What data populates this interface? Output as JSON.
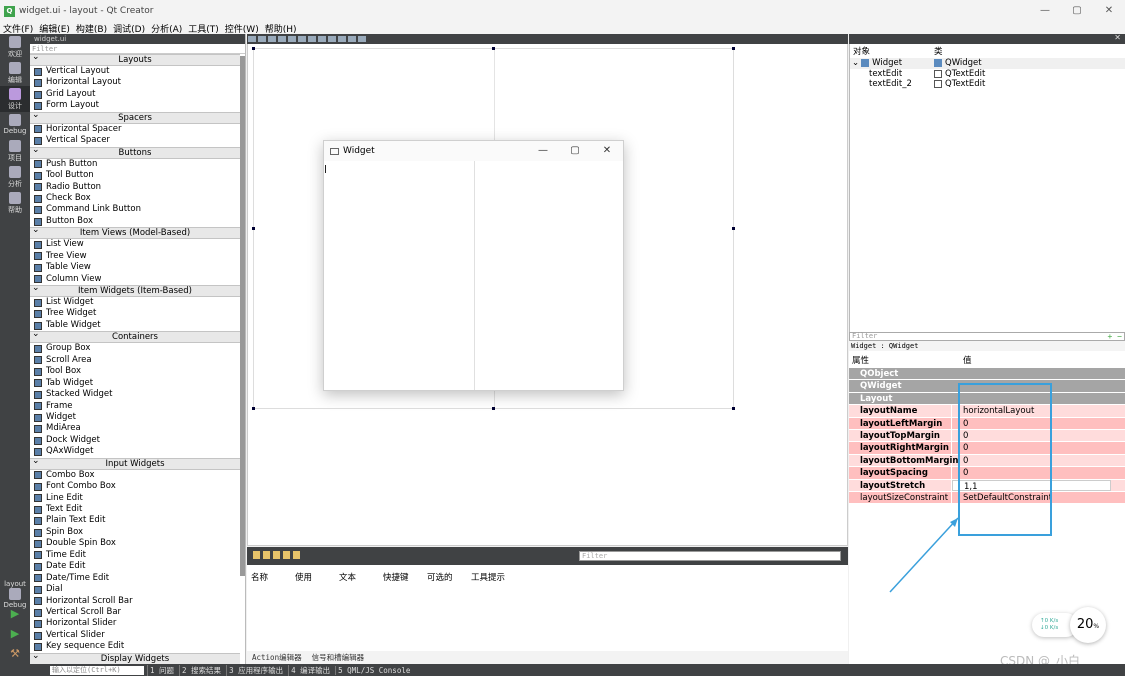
{
  "window": {
    "title": "widget.ui - layout - Qt Creator",
    "minimize": "—",
    "maximize": "▢",
    "close": "✕"
  },
  "menu": [
    "文件(F)",
    "编辑(E)",
    "构建(B)",
    "调试(D)",
    "分析(A)",
    "工具(T)",
    "控件(W)",
    "帮助(H)"
  ],
  "modes": [
    "欢迎",
    "编辑",
    "设计",
    "Debug",
    "项目",
    "分析",
    "帮助"
  ],
  "mode_bottom": {
    "project": "layout",
    "config": "Debug"
  },
  "widgetbox": {
    "file": "widget.ui",
    "filter_placeholder": "Filter",
    "categories": [
      {
        "name": "Layouts",
        "items": [
          "Vertical Layout",
          "Horizontal Layout",
          "Grid Layout",
          "Form Layout"
        ]
      },
      {
        "name": "Spacers",
        "items": [
          "Horizontal Spacer",
          "Vertical Spacer"
        ]
      },
      {
        "name": "Buttons",
        "items": [
          "Push Button",
          "Tool Button",
          "Radio Button",
          "Check Box",
          "Command Link Button",
          "Button Box"
        ]
      },
      {
        "name": "Item Views (Model-Based)",
        "items": [
          "List View",
          "Tree View",
          "Table View",
          "Column View"
        ]
      },
      {
        "name": "Item Widgets (Item-Based)",
        "items": [
          "List Widget",
          "Tree Widget",
          "Table Widget"
        ]
      },
      {
        "name": "Containers",
        "items": [
          "Group Box",
          "Scroll Area",
          "Tool Box",
          "Tab Widget",
          "Stacked Widget",
          "Frame",
          "Widget",
          "MdiArea",
          "Dock Widget",
          "QAxWidget"
        ]
      },
      {
        "name": "Input Widgets",
        "items": [
          "Combo Box",
          "Font Combo Box",
          "Line Edit",
          "Text Edit",
          "Plain Text Edit",
          "Spin Box",
          "Double Spin Box",
          "Time Edit",
          "Date Edit",
          "Date/Time Edit",
          "Dial",
          "Horizontal Scroll Bar",
          "Vertical Scroll Bar",
          "Horizontal Slider",
          "Vertical Slider",
          "Key sequence Edit"
        ]
      },
      {
        "name": "Display Widgets",
        "items": []
      }
    ]
  },
  "preview": {
    "title": "Widget",
    "minimize": "—",
    "maximize": "▢",
    "close": "✕"
  },
  "actions": {
    "filter_placeholder": "Filter",
    "columns": [
      "名称",
      "使用",
      "文本",
      "快捷键",
      "可选的",
      "工具提示"
    ],
    "tabs": [
      "Action编辑器",
      "信号和槽编辑器"
    ]
  },
  "objects": {
    "header": [
      "对象",
      "类"
    ],
    "rows": [
      {
        "name": "Widget",
        "class": "QWidget"
      },
      {
        "name": "textEdit",
        "class": "QTextEdit"
      },
      {
        "name": "textEdit_2",
        "class": "QTextEdit"
      }
    ]
  },
  "properties": {
    "filter_placeholder": "Filter",
    "subtitle": "Widget : QWidget",
    "header": [
      "属性",
      "值"
    ],
    "groups": [
      "QObject",
      "QWidget",
      "Layout"
    ],
    "rows": [
      {
        "key": "layoutName",
        "value": "horizontalLayout"
      },
      {
        "key": "layoutLeftMargin",
        "value": "0"
      },
      {
        "key": "layoutTopMargin",
        "value": "0"
      },
      {
        "key": "layoutRightMargin",
        "value": "0"
      },
      {
        "key": "layoutBottomMargin",
        "value": "0"
      },
      {
        "key": "layoutSpacing",
        "value": "0"
      },
      {
        "key": "layoutStretch",
        "value": "1,1"
      },
      {
        "key": "layoutSizeConstraint",
        "value": "SetDefaultConstraint"
      }
    ]
  },
  "network": {
    "up": "↑0 K/s",
    "down": "↓0 K/s",
    "percent": "20",
    "unit": "%"
  },
  "watermark": "CSDN @_小白__",
  "statusbar": {
    "locator_placeholder": "输入以定位(Ctrl+K)",
    "tabs": [
      "1 问题",
      "2 搜索结果",
      "3 应用程序输出",
      "4 编译输出",
      "5 QML/JS Console"
    ]
  },
  "colors": {
    "highlight": "#3aa0dc",
    "prop_changed": "#ffbfbf",
    "group_bg": "#a5a5a5",
    "sidebar": "#404244"
  }
}
